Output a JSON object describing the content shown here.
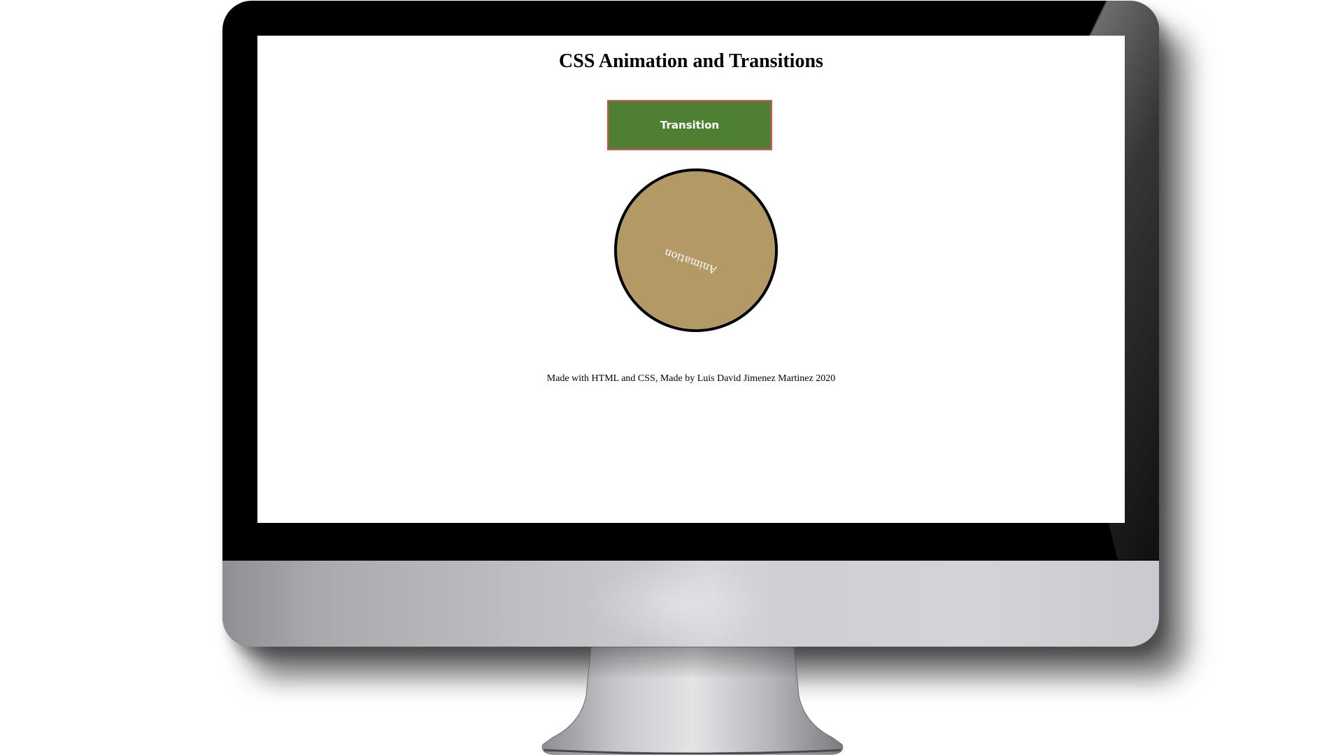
{
  "page": {
    "title": "CSS Animation and Transitions",
    "transition_button_label": "Transition",
    "animation_label": "Animation",
    "footer": "Made with HTML and CSS, Made by Luis David Jimenez Martinez 2020"
  },
  "colors": {
    "button_fill": "#4e7f33",
    "button_border": "#d9534f",
    "circle_fill": "#b29965",
    "circle_border": "#000000",
    "monitor_bezel": "#000000",
    "monitor_chin": "#c9c9ce"
  }
}
